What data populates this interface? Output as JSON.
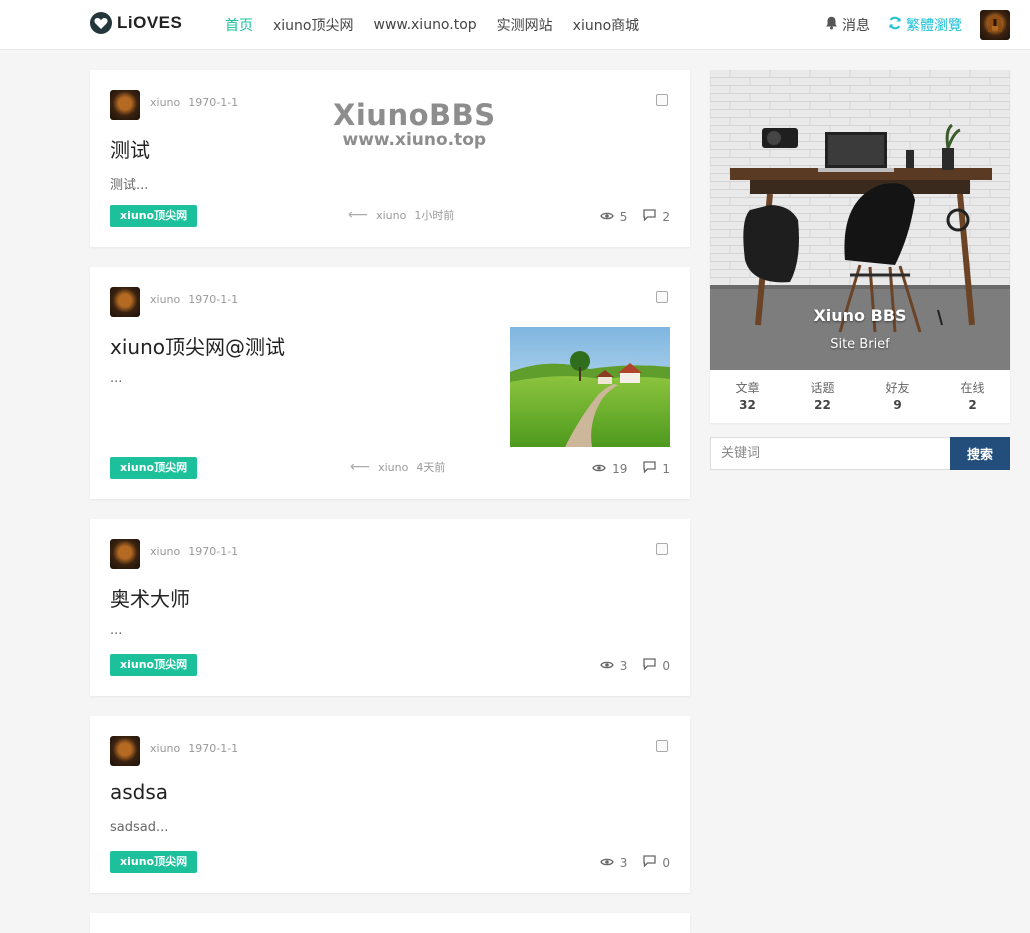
{
  "header": {
    "logo_text": "LiOVES",
    "nav": [
      "首页",
      "xiuno顶尖网",
      "www.xiuno.top",
      "实测网站",
      "xiuno商城"
    ],
    "message_label": "消息",
    "trad_label": "繁體瀏覽"
  },
  "watermark": {
    "line1": "XiunoBBS",
    "line2": "www.xiuno.top"
  },
  "threads": [
    {
      "author": "xiuno",
      "date": "1970-1-1",
      "title": "测试",
      "excerpt": "测试...",
      "tag": "xiuno顶尖网",
      "last_user": "xiuno",
      "last_time": "1小时前",
      "views": "5",
      "replies": "2"
    },
    {
      "author": "xiuno",
      "date": "1970-1-1",
      "title": "xiuno顶尖网@测试",
      "excerpt": "...",
      "tag": "xiuno顶尖网",
      "last_user": "xiuno",
      "last_time": "4天前",
      "views": "19",
      "replies": "1"
    },
    {
      "author": "xiuno",
      "date": "1970-1-1",
      "title": "奥术大师",
      "excerpt": "...",
      "tag": "xiuno顶尖网",
      "last_user": "",
      "last_time": "",
      "views": "3",
      "replies": "0"
    },
    {
      "author": "xiuno",
      "date": "1970-1-1",
      "title": "asdsa",
      "excerpt": "sadsad...",
      "tag": "xiuno顶尖网",
      "last_user": "",
      "last_time": "",
      "views": "3",
      "replies": "0"
    }
  ],
  "sidebar": {
    "site_name": "Xiuno BBS",
    "site_brief": "Site Brief",
    "stats": [
      {
        "label": "文章",
        "value": "32"
      },
      {
        "label": "话题",
        "value": "22"
      },
      {
        "label": "好友",
        "value": "9"
      },
      {
        "label": "在线",
        "value": "2"
      }
    ]
  },
  "search": {
    "placeholder": "关键词",
    "button": "搜索"
  },
  "colors": {
    "accent": "#1cc1a0",
    "tag": "#1cc19b",
    "search_button": "#234e7c"
  }
}
